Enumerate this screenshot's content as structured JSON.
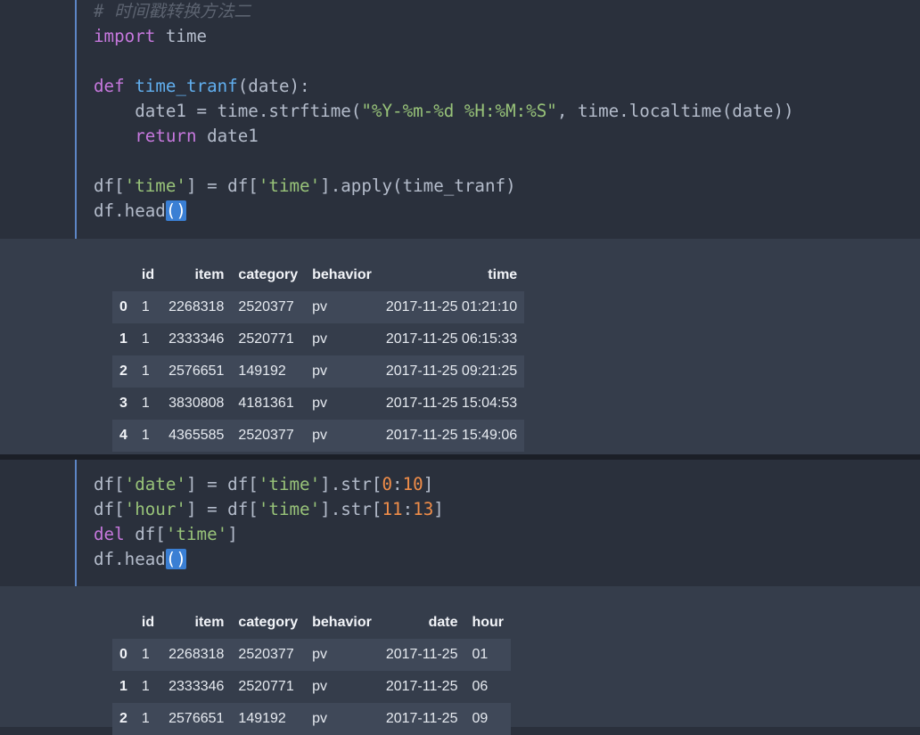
{
  "cell1": {
    "lines": [
      [
        {
          "t": "# 时间戳转换方法二",
          "c": "cm"
        }
      ],
      [
        {
          "t": "import",
          "c": "kw"
        },
        {
          "t": " time"
        }
      ],
      [],
      [
        {
          "t": "def",
          "c": "kw"
        },
        {
          "t": " "
        },
        {
          "t": "time_tranf",
          "c": "fn"
        },
        {
          "t": "(date):"
        }
      ],
      [
        {
          "t": "    date1 = time.strftime("
        },
        {
          "t": "\"%Y-%m-%d %H:%M:%S\"",
          "c": "str"
        },
        {
          "t": ", time.localtime(date))"
        }
      ],
      [
        {
          "t": "    "
        },
        {
          "t": "return",
          "c": "kw"
        },
        {
          "t": " date1"
        }
      ],
      [],
      [
        {
          "t": "df["
        },
        {
          "t": "'time'",
          "c": "str"
        },
        {
          "t": "] = df["
        },
        {
          "t": "'time'",
          "c": "str"
        },
        {
          "t": "].apply(time_tranf)"
        }
      ],
      [
        {
          "t": "df.head"
        },
        {
          "t": "()",
          "c": "brk"
        }
      ]
    ]
  },
  "table1": {
    "columns": [
      "",
      "id",
      "item",
      "category",
      "behavior",
      "time"
    ],
    "rows": [
      [
        "0",
        "1",
        "2268318",
        "2520377",
        "pv",
        "2017-11-25 01:21:10"
      ],
      [
        "1",
        "1",
        "2333346",
        "2520771",
        "pv",
        "2017-11-25 06:15:33"
      ],
      [
        "2",
        "1",
        "2576651",
        "149192",
        "pv",
        "2017-11-25 09:21:25"
      ],
      [
        "3",
        "1",
        "3830808",
        "4181361",
        "pv",
        "2017-11-25 15:04:53"
      ],
      [
        "4",
        "1",
        "4365585",
        "2520377",
        "pv",
        "2017-11-25 15:49:06"
      ]
    ]
  },
  "cell2": {
    "lines": [
      [
        {
          "t": "df["
        },
        {
          "t": "'date'",
          "c": "str"
        },
        {
          "t": "] = df["
        },
        {
          "t": "'time'",
          "c": "str"
        },
        {
          "t": "].str["
        },
        {
          "t": "0",
          "c": "num"
        },
        {
          "t": ":"
        },
        {
          "t": "10",
          "c": "num"
        },
        {
          "t": "]"
        }
      ],
      [
        {
          "t": "df["
        },
        {
          "t": "'hour'",
          "c": "str"
        },
        {
          "t": "] = df["
        },
        {
          "t": "'time'",
          "c": "str"
        },
        {
          "t": "].str["
        },
        {
          "t": "11",
          "c": "num"
        },
        {
          "t": ":"
        },
        {
          "t": "13",
          "c": "num"
        },
        {
          "t": "]"
        }
      ],
      [
        {
          "t": "del",
          "c": "kw"
        },
        {
          "t": " df["
        },
        {
          "t": "'time'",
          "c": "str"
        },
        {
          "t": "]"
        }
      ],
      [
        {
          "t": "df.head"
        },
        {
          "t": "()",
          "c": "brk"
        }
      ]
    ]
  },
  "table2": {
    "columns": [
      "",
      "id",
      "item",
      "category",
      "behavior",
      "date",
      "hour"
    ],
    "rows": [
      [
        "0",
        "1",
        "2268318",
        "2520377",
        "pv",
        "2017-11-25",
        "01"
      ],
      [
        "1",
        "1",
        "2333346",
        "2520771",
        "pv",
        "2017-11-25",
        "06"
      ],
      [
        "2",
        "1",
        "2576651",
        "149192",
        "pv",
        "2017-11-25",
        "09"
      ]
    ]
  }
}
